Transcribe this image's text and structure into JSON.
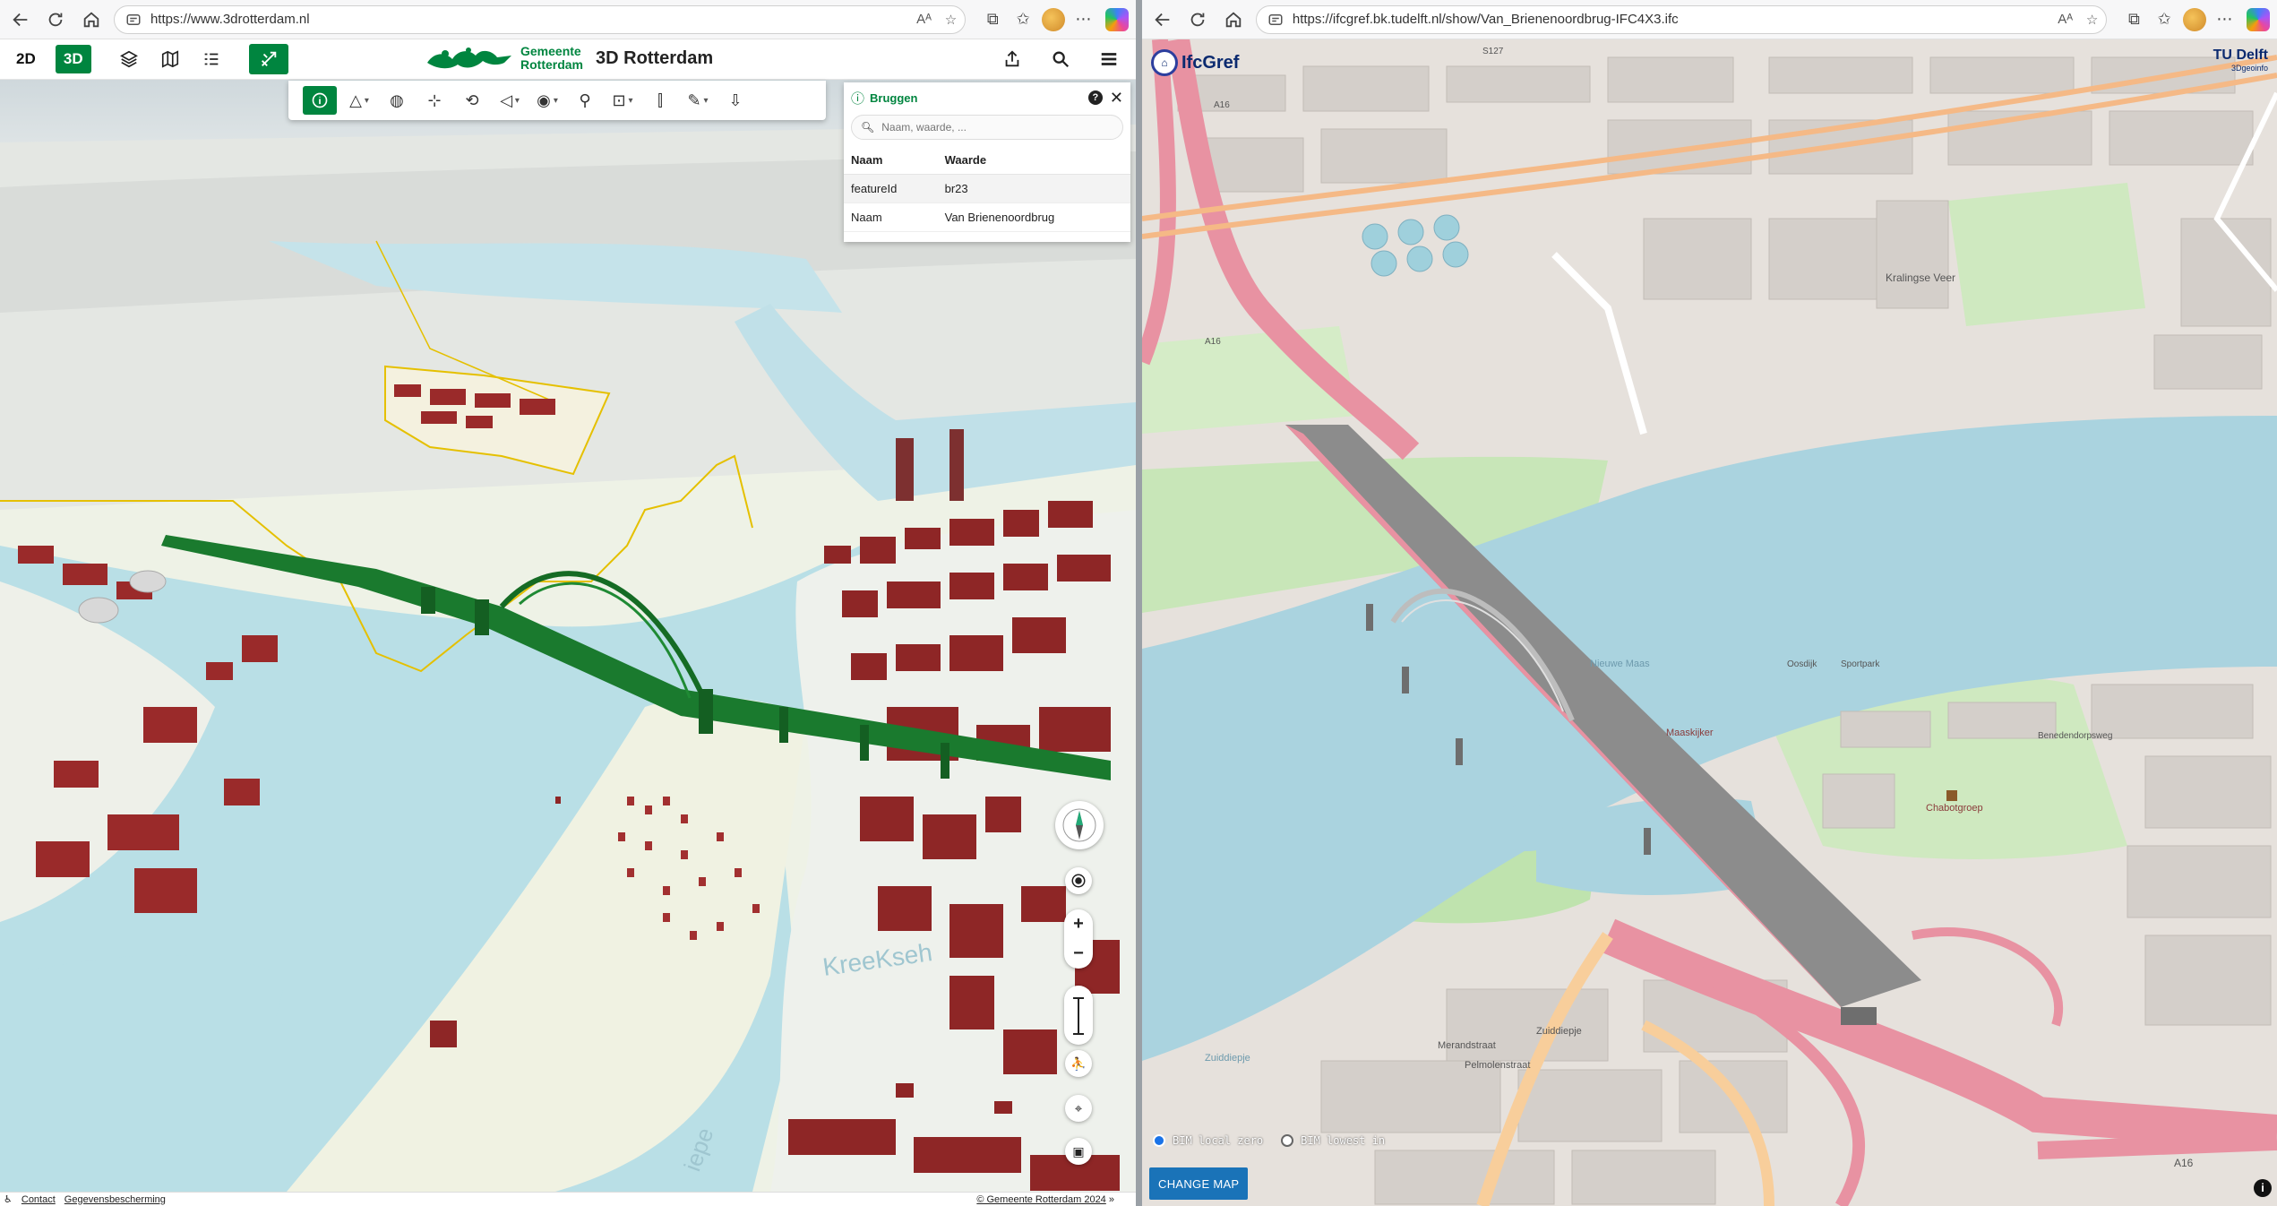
{
  "left": {
    "url": "https://www.3drotterdam.nl",
    "view_modes": [
      "2D",
      "3D"
    ],
    "active_mode": "3D",
    "logo_text_1": "Gemeente",
    "logo_text_2": "Rotterdam",
    "app_title": "3D Rotterdam",
    "info_panel": {
      "title": "Bruggen",
      "search_placeholder": "Naam, waarde, ...",
      "col_name": "Naam",
      "col_value": "Waarde",
      "rows": [
        {
          "name": "featureId",
          "value": "br23"
        },
        {
          "name": "Naam",
          "value": "Van Brienenoordbrug"
        }
      ]
    },
    "map_labels": {
      "water": "KreeKseh",
      "water2": "iepe"
    },
    "footer": {
      "contact": "Contact",
      "privacy": "Gegevensbescherming",
      "copyright": "© Gemeente Rotterdam 2024"
    },
    "colors": {
      "accent": "#00853f",
      "bridge": "#1a7a2e",
      "water": "#b9dfe6"
    }
  },
  "right": {
    "url": "https://ifcgref.bk.tudelft.nl/show/Van_Brienenoordbrug-IFC4X3.ifc",
    "logo": "IfcGref",
    "tud_logo_1": "TU",
    "tud_logo_2": "Delft",
    "tud_logo_3": "3Dgeoinfo",
    "radio_1": "BIM local zero",
    "radio_2": "BIM lowest in",
    "change_map": "CHANGE MAP",
    "map_labels": {
      "a16_top": "A16",
      "a16_left": "A16",
      "a16_bottom": "A16",
      "s127": "S127",
      "kralingse_veer": "Kralingse Veer",
      "maaskijker": "Maaskijker",
      "chabotgroep": "Chabotgroep",
      "zuiddiepje": "Zuiddiepje",
      "merandstraat": "Merandstraat",
      "pelmolenstraat": "Pelmolenstraat",
      "zuiddiepje2": "Zuiddiepje",
      "oosdijk": "Oosdijk",
      "sportpark": "Sportpark",
      "beneden": "Benedendorpsweg",
      "nieuwe_maas": "Nieuwe Maas"
    },
    "colors": {
      "water": "#aad3df",
      "motorway": "#e892a2",
      "bridge": "#8c8c8c"
    }
  }
}
